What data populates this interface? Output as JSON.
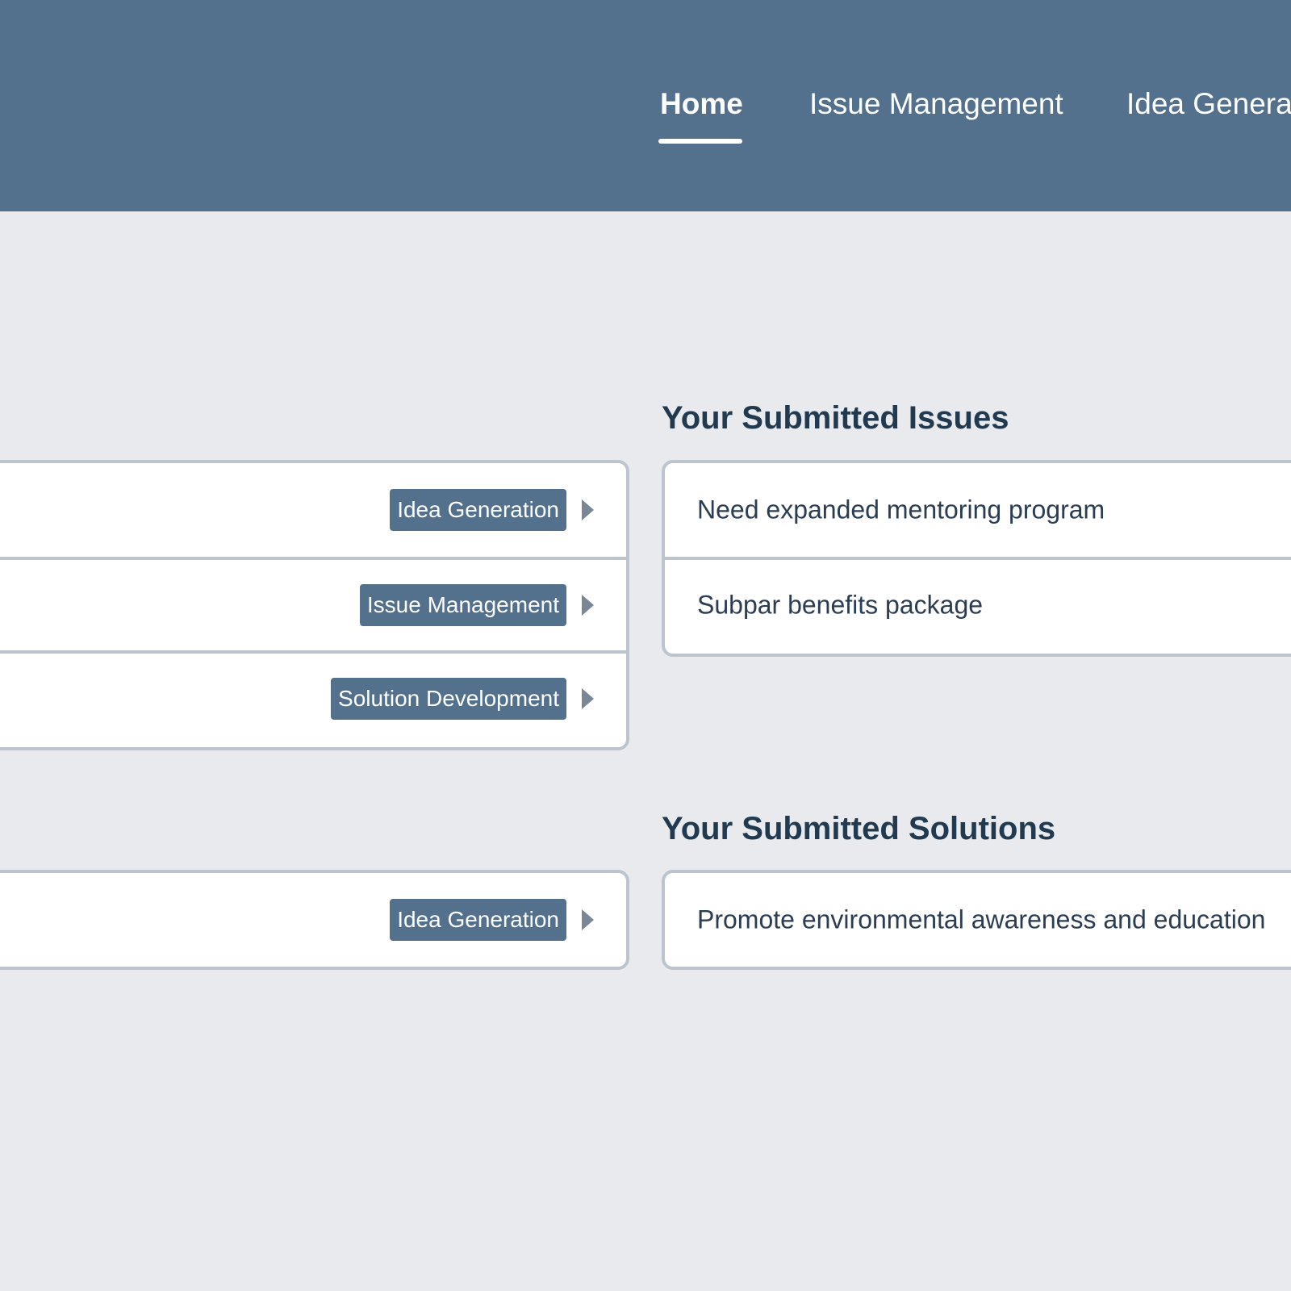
{
  "nav": {
    "items": [
      {
        "label": "Home",
        "active": true
      },
      {
        "label": "Issue Management",
        "active": false
      },
      {
        "label": "Idea Generat",
        "active": false
      }
    ]
  },
  "issues_section": {
    "title": "Your Submitted Issues",
    "left_items": [
      {
        "tag": "Idea Generation"
      },
      {
        "tag": "Issue Management"
      },
      {
        "tag": "Solution Development"
      }
    ],
    "right_items": [
      {
        "text": "Need expanded mentoring program"
      },
      {
        "text": "Subpar benefits package"
      }
    ]
  },
  "solutions_section": {
    "title": "Your Submitted Solutions",
    "left_items": [
      {
        "tag": "Idea Generation"
      }
    ],
    "right_items": [
      {
        "text": "Promote environmental awareness and education"
      }
    ]
  },
  "colors": {
    "header_bg": "#53708d",
    "page_bg": "#e8eaee",
    "tag_bg": "#53708d",
    "title_text": "#213a50",
    "card_border": "#bcc4d0"
  },
  "icons": {
    "row_arrow": "caret-right-icon"
  }
}
